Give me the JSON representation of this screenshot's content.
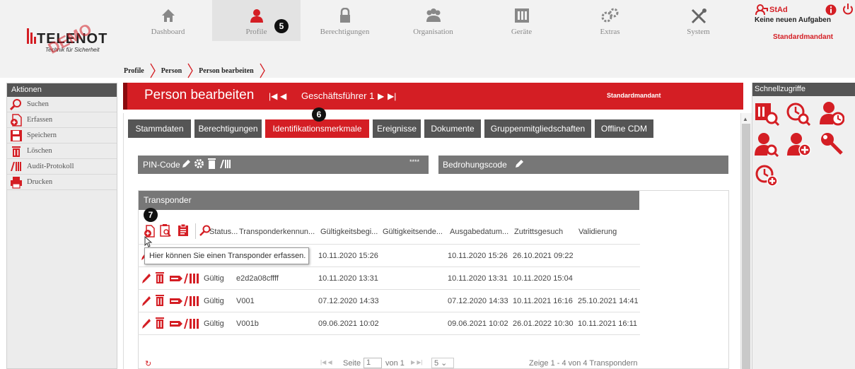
{
  "logo": {
    "brand": "TELENOT",
    "tagline": "Technik für Sicherheit",
    "watermark": "DEMO"
  },
  "nav": {
    "items": [
      {
        "label": "Dashboard",
        "icon": "home-icon"
      },
      {
        "label": "Profile",
        "icon": "person-icon"
      },
      {
        "label": "Berechtigungen",
        "icon": "lock-icon"
      },
      {
        "label": "Organisation",
        "icon": "group-icon"
      },
      {
        "label": "Geräte",
        "icon": "device-icon"
      },
      {
        "label": "Extras",
        "icon": "gears-icon"
      },
      {
        "label": "System",
        "icon": "tools-icon"
      }
    ]
  },
  "user": {
    "name": "StAd",
    "tasks": "Keine neuen Aufgaben",
    "client": "Standardmandant"
  },
  "breadcrumb": [
    "Profile",
    "Person",
    "Person bearbeiten"
  ],
  "actions": {
    "title": "Aktionen",
    "items": [
      "Suchen",
      "Erfassen",
      "Speichern",
      "Löschen",
      "Audit-Protokoll",
      "Drucken"
    ]
  },
  "quick": {
    "title": "Schnellzugriffe"
  },
  "header": {
    "title": "Person bearbeiten",
    "record": "Geschäftsführer 1",
    "client": "Standardmandant"
  },
  "tabs": [
    "Stammdaten",
    "Berechtigungen",
    "Identifikationsmerkmale",
    "Ereignisse",
    "Dokumente",
    "Gruppenmitgliedschaften",
    "Offline CDM"
  ],
  "pin": {
    "label": "PIN-Code",
    "value": "****"
  },
  "threat": {
    "label": "Bedrohungscode"
  },
  "transponder": {
    "title": "Transponder",
    "columns": [
      "Status...",
      "Transponderkennun...",
      "Gültigkeitsbegi...",
      "Gültigkeitsende...",
      "Ausgabedatum...",
      "Zutrittsgesuch",
      "Validierung"
    ],
    "tooltip": "Hier können Sie einen Transponder erfassen.",
    "rows": [
      {
        "status": "",
        "id": "",
        "begin": "10.11.2020 15:26",
        "end": "",
        "issue": "10.11.2020 15:26",
        "request": "26.10.2021 09:22",
        "valid": ""
      },
      {
        "status": "Gültig",
        "id": "e2d2a08cffff",
        "begin": "10.11.2020 13:31",
        "end": "",
        "issue": "10.11.2020 13:31",
        "request": "10.11.2020 15:04",
        "valid": ""
      },
      {
        "status": "Gültig",
        "id": "V001",
        "begin": "07.12.2020 14:33",
        "end": "",
        "issue": "07.12.2020 14:33",
        "request": "10.11.2021 16:16",
        "valid": "25.10.2021 14:41"
      },
      {
        "status": "Gültig",
        "id": "V001b",
        "begin": "09.06.2021 10:02",
        "end": "",
        "issue": "09.06.2021 10:02",
        "request": "26.01.2022 10:30",
        "valid": "10.11.2021 16:11"
      }
    ],
    "pager": {
      "page_label": "Seite",
      "page": "1",
      "of_label": "von 1",
      "page_size": "5",
      "summary": "Zeige 1 - 4 von 4 Transpondern"
    }
  },
  "markers": [
    "5",
    "6",
    "7"
  ],
  "colors": {
    "accent": "#d41e24",
    "bar": "#555555",
    "section": "#777777"
  }
}
